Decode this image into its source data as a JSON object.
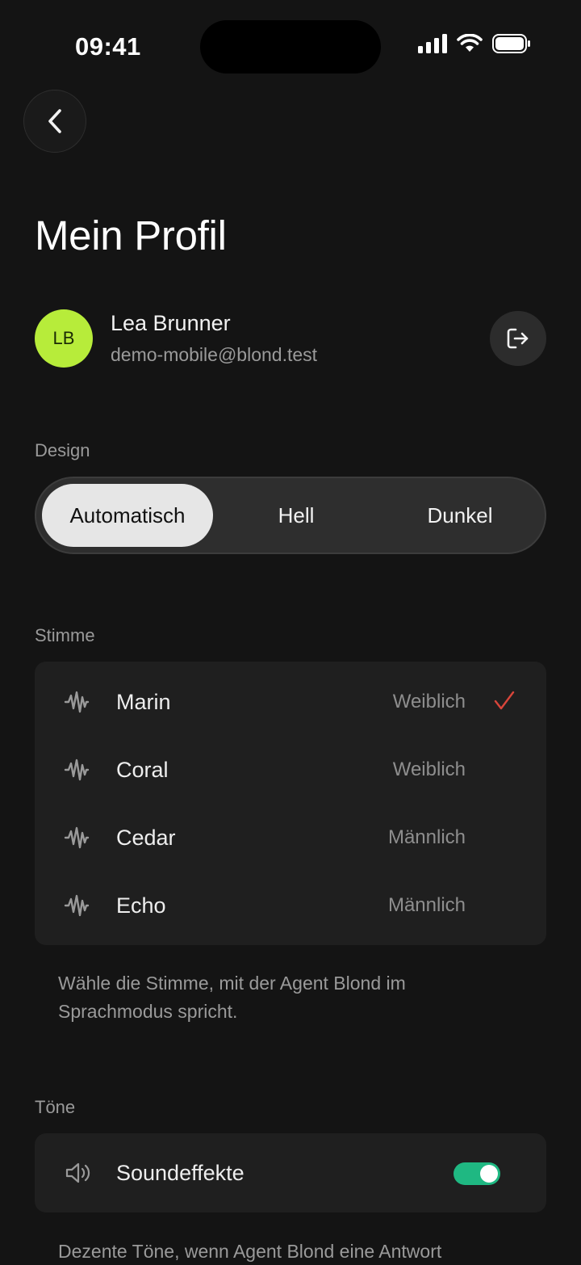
{
  "status_bar": {
    "time": "09:41"
  },
  "header": {
    "title": "Mein Profil"
  },
  "profile": {
    "initials": "LB",
    "avatar_color": "#b7ec3a",
    "name": "Lea Brunner",
    "email": "demo-mobile@blond.test"
  },
  "design": {
    "label": "Design",
    "options": [
      "Automatisch",
      "Hell",
      "Dunkel"
    ],
    "selected": "Automatisch"
  },
  "voice": {
    "label": "Stimme",
    "items": [
      {
        "name": "Marin",
        "gender": "Weiblich",
        "selected": true
      },
      {
        "name": "Coral",
        "gender": "Weiblich",
        "selected": false
      },
      {
        "name": "Cedar",
        "gender": "Männlich",
        "selected": false
      },
      {
        "name": "Echo",
        "gender": "Männlich",
        "selected": false
      }
    ],
    "help": "Wähle die Stimme, mit der Agent Blond im Sprachmodus spricht.",
    "check_color": "#d8453a"
  },
  "tones": {
    "label": "Töne",
    "sound_effects_label": "Soundeffekte",
    "sound_effects_on": true,
    "toggle_color": "#1fb882",
    "help": "Dezente Töne, wenn Agent Blond eine Antwort"
  }
}
